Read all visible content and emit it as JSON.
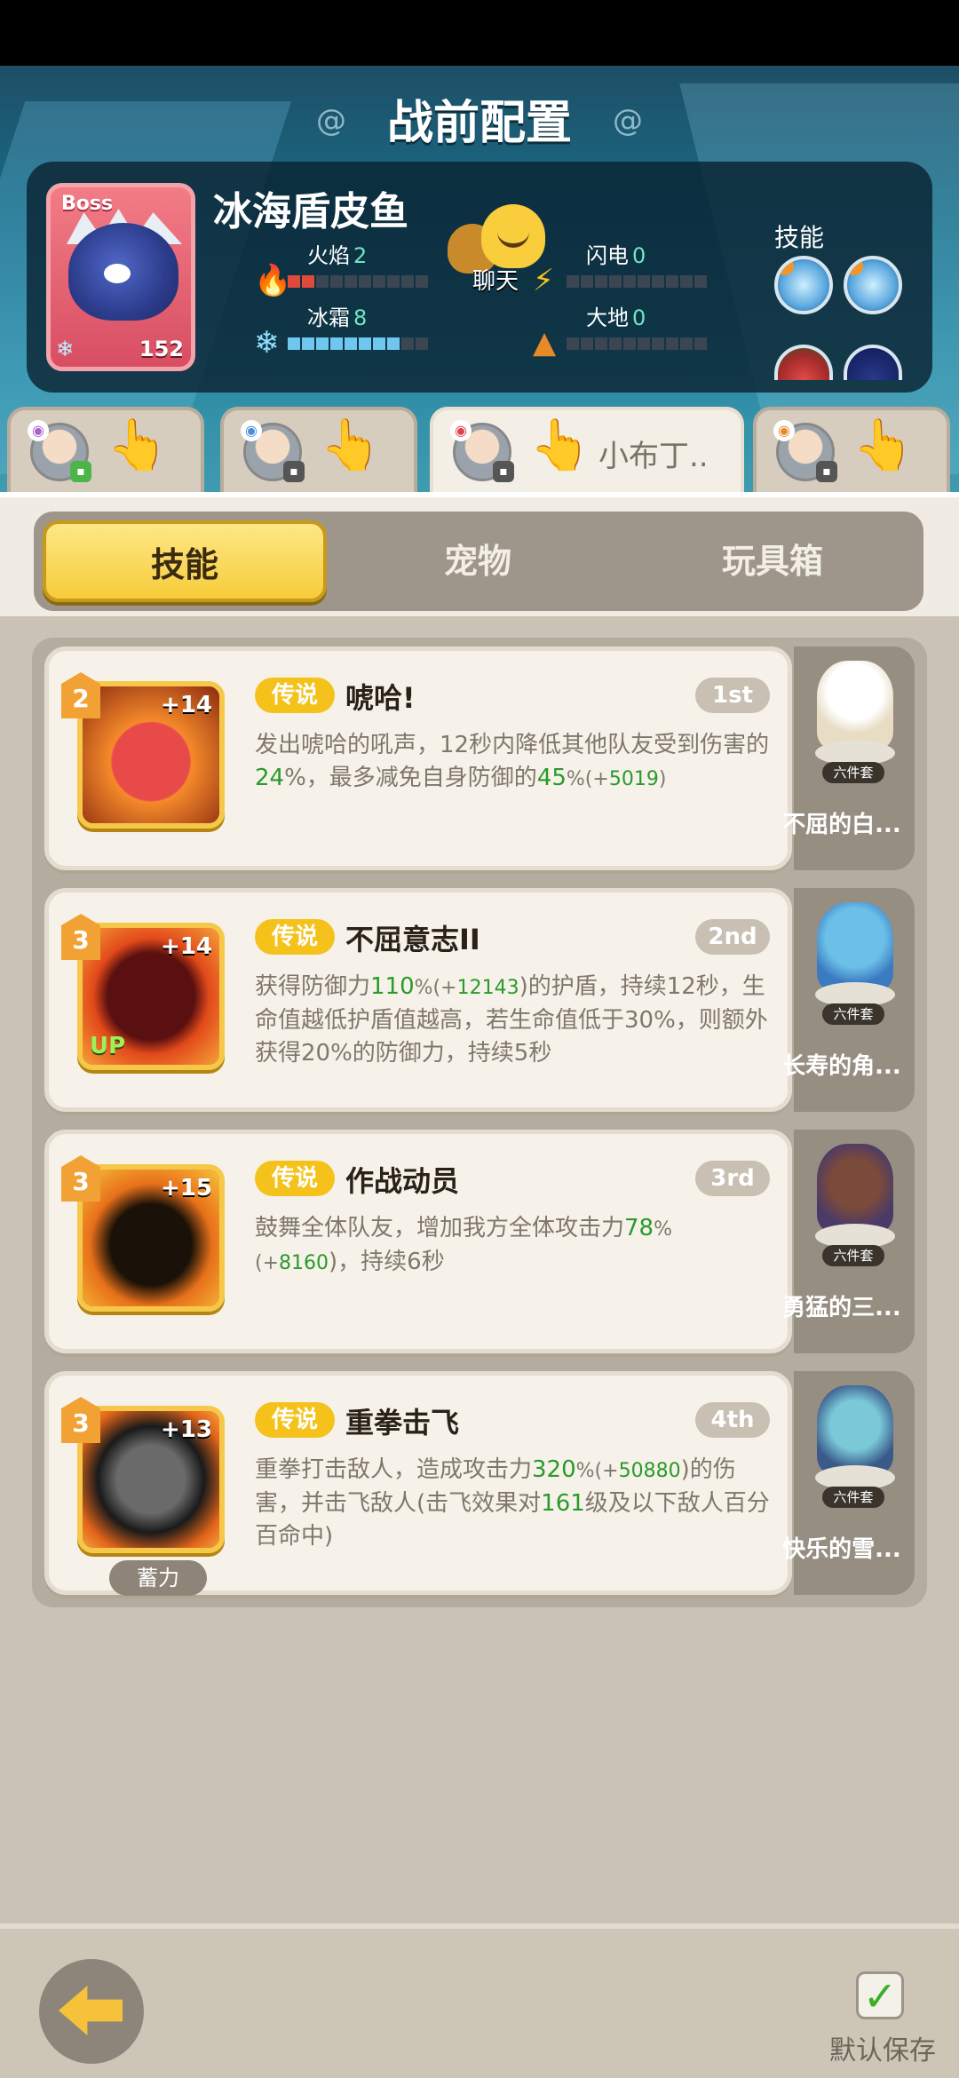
{
  "header": {
    "title": "战前配置"
  },
  "boss": {
    "tag": "Boss",
    "name": "冰海盾皮鱼",
    "level": "152",
    "stats": [
      {
        "label": "火焰",
        "value": "2"
      },
      {
        "label": "冰霜",
        "value": "8"
      },
      {
        "label": "闪电",
        "value": "0"
      },
      {
        "label": "大地",
        "value": "0"
      }
    ],
    "chat_label": "聊天",
    "skills_label": "技能"
  },
  "team": {
    "active_slot_name": "小布丁.."
  },
  "tabs": [
    "技能",
    "宠物",
    "玩具箱"
  ],
  "skills": [
    {
      "level": "2",
      "plus": "+14",
      "rarity": "传说",
      "name": "唬哈!",
      "order": "1st",
      "up": "",
      "charge": "",
      "desc": [
        "发出唬哈的吼声，12秒内降低其他队友受到伤害的",
        "24",
        "%，最多减免自身防御的",
        "45",
        "%(+",
        "5019",
        ")"
      ],
      "pet": "不屈的白..."
    },
    {
      "level": "3",
      "plus": "+14",
      "rarity": "传说",
      "name": "不屈意志II",
      "order": "2nd",
      "up": "UP",
      "charge": "",
      "desc": [
        "获得防御力",
        "110",
        "%(+",
        "12143",
        ")的护盾，持续12秒，生命值越低护盾值越高，若生命值低于30%，则额外获得20%的防御力，持续5秒",
        "",
        "",
        "",
        ""
      ],
      "pet": "长寿的角..."
    },
    {
      "level": "3",
      "plus": "+15",
      "rarity": "传说",
      "name": "作战动员",
      "order": "3rd",
      "up": "",
      "charge": "",
      "desc": [
        "鼓舞全体队友，增加我方全体攻击力",
        "78",
        "%(+",
        "8160",
        ")，持续6秒",
        "",
        "",
        "",
        ""
      ],
      "pet": "勇猛的三..."
    },
    {
      "level": "3",
      "plus": "+13",
      "rarity": "传说",
      "name": "重拳击飞",
      "order": "4th",
      "up": "",
      "charge": "蓄力",
      "desc": [
        "重拳打击敌人，造成攻击力",
        "320",
        "%(+",
        "50880",
        ")的伤害，并击飞敌人(击飞效果对",
        "161",
        "级及以下敌人百分百命中)",
        "",
        ""
      ],
      "pet": "快乐的雪..."
    }
  ],
  "pet_set_label": "六件套",
  "footer": {
    "save_label": "默认保存"
  },
  "colors": {
    "legend": "#f5c21b",
    "accent_tab": "#f7cc3a",
    "highlight_green": "#2a9a2a"
  }
}
